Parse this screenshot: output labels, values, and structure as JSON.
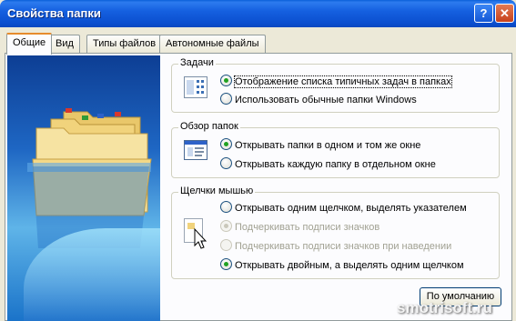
{
  "window": {
    "title": "Свойства папки",
    "help_label": "?",
    "close_label": "✕"
  },
  "tabs": [
    {
      "label": "Общие",
      "active": true
    },
    {
      "label": "Вид"
    },
    {
      "label": "Типы файлов"
    },
    {
      "label": "Автономные файлы"
    }
  ],
  "tasks": {
    "legend": "Задачи",
    "options": [
      {
        "label": "Отображение списка типичных задач в папках",
        "checked": true
      },
      {
        "label": "Использовать обычные папки Windows",
        "checked": false
      }
    ]
  },
  "browse": {
    "legend": "Обзор папок",
    "options": [
      {
        "label": "Открывать папки в одном и том же окне",
        "checked": true
      },
      {
        "label": "Открывать каждую папку в отдельном окне",
        "checked": false
      }
    ]
  },
  "clicks": {
    "legend": "Щелчки мышью",
    "options": [
      {
        "label": "Открывать одним щелчком, выделять указателем",
        "checked": false
      },
      {
        "label": "Подчеркивать подписи значков",
        "checked": true,
        "disabled": true
      },
      {
        "label": "Подчеркивать подписи значков при наведении",
        "checked": false,
        "disabled": true
      },
      {
        "label": "Открывать двойным, а выделять одним щелчком",
        "checked": true
      }
    ]
  },
  "buttons": {
    "restore_defaults": "По умолчанию"
  },
  "watermark": "smotrisoft.ru"
}
